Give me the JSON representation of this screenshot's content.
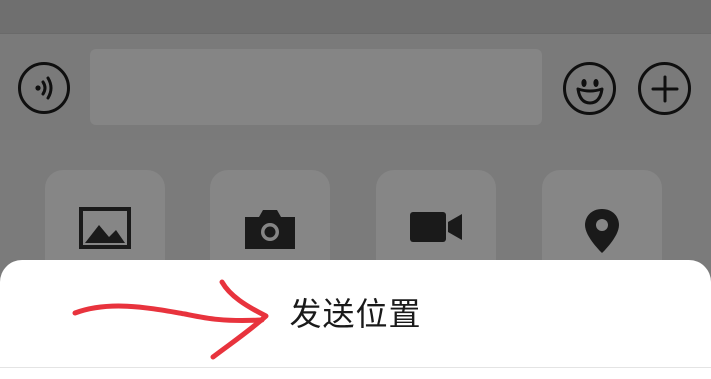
{
  "chat_input": {
    "voice_icon": "voice-input-icon",
    "emoji_icon": "emoji-icon",
    "plus_icon": "plus-icon"
  },
  "attachment_panel": {
    "items": [
      {
        "icon": "photo-icon"
      },
      {
        "icon": "camera-icon"
      },
      {
        "icon": "video-call-icon"
      },
      {
        "icon": "location-icon"
      }
    ]
  },
  "action_sheet": {
    "send_location_label": "发送位置"
  },
  "colors": {
    "overlay": "#7c7c7c",
    "sheet": "#ffffff",
    "annotation": "#e8333d"
  }
}
